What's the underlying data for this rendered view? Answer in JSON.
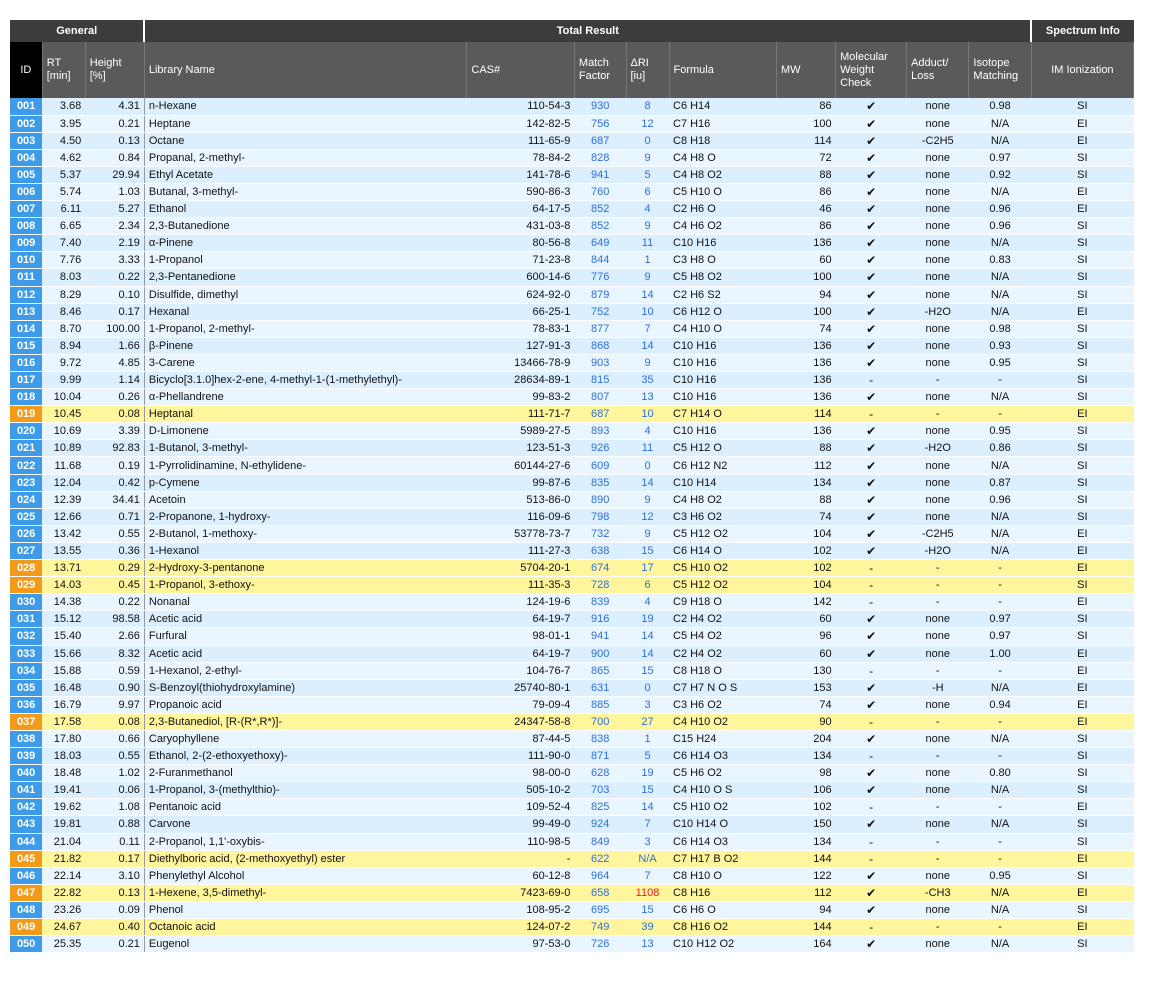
{
  "groups": {
    "general": "General",
    "total": "Total Result",
    "spectrum": "Spectrum Info"
  },
  "columns": {
    "id": "ID",
    "rt": "RT [min]",
    "height": "Height [%]",
    "library": "Library Name",
    "cas": "CAS#",
    "match": "Match Factor",
    "dri": "ΔRI [iu]",
    "formula": "Formula",
    "mw": "MW",
    "mwcheck": "Molecular Weight Check",
    "adduct": "Adduct/ Loss",
    "isotope": "Isotope Matching",
    "ion": "IM Ionization"
  },
  "colors": {
    "highlight": "#fff59d",
    "id_blue": "#3d9be8",
    "id_orange": "#f29a1a",
    "link_blue": "#2f6fd6",
    "alert_red": "#e02020"
  },
  "rows": [
    {
      "id": "001",
      "rt": "3.68",
      "height": "4.31",
      "name": "n-Hexane",
      "cas": "110-54-3",
      "match": "930",
      "dri": "8",
      "formula": "C6 H14",
      "mw": "86",
      "check": "✔",
      "adduct": "none",
      "isotope": "0.98",
      "ion": "SI",
      "hl": false
    },
    {
      "id": "002",
      "rt": "3.95",
      "height": "0.21",
      "name": "Heptane",
      "cas": "142-82-5",
      "match": "756",
      "dri": "12",
      "formula": "C7 H16",
      "mw": "100",
      "check": "✔",
      "adduct": "none",
      "isotope": "N/A",
      "ion": "EI",
      "hl": false
    },
    {
      "id": "003",
      "rt": "4.50",
      "height": "0.13",
      "name": "Octane",
      "cas": "111-65-9",
      "match": "687",
      "dri": "0",
      "formula": "C8 H18",
      "mw": "114",
      "check": "✔",
      "adduct": "-C2H5",
      "isotope": "N/A",
      "ion": "EI",
      "hl": false
    },
    {
      "id": "004",
      "rt": "4.62",
      "height": "0.84",
      "name": "Propanal, 2-methyl-",
      "cas": "78-84-2",
      "match": "828",
      "dri": "9",
      "formula": "C4 H8 O",
      "mw": "72",
      "check": "✔",
      "adduct": "none",
      "isotope": "0.97",
      "ion": "SI",
      "hl": false
    },
    {
      "id": "005",
      "rt": "5.37",
      "height": "29.94",
      "name": "Ethyl Acetate",
      "cas": "141-78-6",
      "match": "941",
      "dri": "5",
      "formula": "C4 H8 O2",
      "mw": "88",
      "check": "✔",
      "adduct": "none",
      "isotope": "0.92",
      "ion": "SI",
      "hl": false
    },
    {
      "id": "006",
      "rt": "5.74",
      "height": "1.03",
      "name": "Butanal, 3-methyl-",
      "cas": "590-86-3",
      "match": "760",
      "dri": "6",
      "formula": "C5 H10 O",
      "mw": "86",
      "check": "✔",
      "adduct": "none",
      "isotope": "N/A",
      "ion": "EI",
      "hl": false
    },
    {
      "id": "007",
      "rt": "6.11",
      "height": "5.27",
      "name": "Ethanol",
      "cas": "64-17-5",
      "match": "852",
      "dri": "4",
      "formula": "C2 H6 O",
      "mw": "46",
      "check": "✔",
      "adduct": "none",
      "isotope": "0.96",
      "ion": "EI",
      "hl": false
    },
    {
      "id": "008",
      "rt": "6.65",
      "height": "2.34",
      "name": "2,3-Butanedione",
      "cas": "431-03-8",
      "match": "852",
      "dri": "9",
      "formula": "C4 H6 O2",
      "mw": "86",
      "check": "✔",
      "adduct": "none",
      "isotope": "0.96",
      "ion": "SI",
      "hl": false
    },
    {
      "id": "009",
      "rt": "7.40",
      "height": "2.19",
      "name": "α-Pinene",
      "cas": "80-56-8",
      "match": "649",
      "dri": "11",
      "formula": "C10 H16",
      "mw": "136",
      "check": "✔",
      "adduct": "none",
      "isotope": "N/A",
      "ion": "SI",
      "hl": false
    },
    {
      "id": "010",
      "rt": "7.76",
      "height": "3.33",
      "name": "1-Propanol",
      "cas": "71-23-8",
      "match": "844",
      "dri": "1",
      "formula": "C3 H8 O",
      "mw": "60",
      "check": "✔",
      "adduct": "none",
      "isotope": "0.83",
      "ion": "SI",
      "hl": false
    },
    {
      "id": "011",
      "rt": "8.03",
      "height": "0.22",
      "name": "2,3-Pentanedione",
      "cas": "600-14-6",
      "match": "776",
      "dri": "9",
      "formula": "C5 H8 O2",
      "mw": "100",
      "check": "✔",
      "adduct": "none",
      "isotope": "N/A",
      "ion": "SI",
      "hl": false
    },
    {
      "id": "012",
      "rt": "8.29",
      "height": "0.10",
      "name": "Disulfide, dimethyl",
      "cas": "624-92-0",
      "match": "879",
      "dri": "14",
      "formula": "C2 H6 S2",
      "mw": "94",
      "check": "✔",
      "adduct": "none",
      "isotope": "N/A",
      "ion": "SI",
      "hl": false
    },
    {
      "id": "013",
      "rt": "8.46",
      "height": "0.17",
      "name": "Hexanal",
      "cas": "66-25-1",
      "match": "752",
      "dri": "10",
      "formula": "C6 H12 O",
      "mw": "100",
      "check": "✔",
      "adduct": "-H2O",
      "isotope": "N/A",
      "ion": "EI",
      "hl": false
    },
    {
      "id": "014",
      "rt": "8.70",
      "height": "100.00",
      "name": "1-Propanol, 2-methyl-",
      "cas": "78-83-1",
      "match": "877",
      "dri": "7",
      "formula": "C4 H10 O",
      "mw": "74",
      "check": "✔",
      "adduct": "none",
      "isotope": "0.98",
      "ion": "SI",
      "hl": false
    },
    {
      "id": "015",
      "rt": "8.94",
      "height": "1.66",
      "name": "β-Pinene",
      "cas": "127-91-3",
      "match": "868",
      "dri": "14",
      "formula": "C10 H16",
      "mw": "136",
      "check": "✔",
      "adduct": "none",
      "isotope": "0.93",
      "ion": "SI",
      "hl": false
    },
    {
      "id": "016",
      "rt": "9.72",
      "height": "4.85",
      "name": "3-Carene",
      "cas": "13466-78-9",
      "match": "903",
      "dri": "9",
      "formula": "C10 H16",
      "mw": "136",
      "check": "✔",
      "adduct": "none",
      "isotope": "0.95",
      "ion": "SI",
      "hl": false
    },
    {
      "id": "017",
      "rt": "9.99",
      "height": "1.14",
      "name": "Bicyclo[3.1.0]hex-2-ene, 4-methyl-1-(1-methylethyl)-",
      "cas": "28634-89-1",
      "match": "815",
      "dri": "35",
      "formula": "C10 H16",
      "mw": "136",
      "check": "-",
      "adduct": "-",
      "isotope": "-",
      "ion": "SI",
      "hl": false
    },
    {
      "id": "018",
      "rt": "10.04",
      "height": "0.26",
      "name": "α-Phellandrene",
      "cas": "99-83-2",
      "match": "807",
      "dri": "13",
      "formula": "C10 H16",
      "mw": "136",
      "check": "✔",
      "adduct": "none",
      "isotope": "N/A",
      "ion": "SI",
      "hl": false
    },
    {
      "id": "019",
      "rt": "10.45",
      "height": "0.08",
      "name": "Heptanal",
      "cas": "111-71-7",
      "match": "687",
      "dri": "10",
      "formula": "C7 H14 O",
      "mw": "114",
      "check": "-",
      "adduct": "-",
      "isotope": "-",
      "ion": "EI",
      "hl": true
    },
    {
      "id": "020",
      "rt": "10.69",
      "height": "3.39",
      "name": "D-Limonene",
      "cas": "5989-27-5",
      "match": "893",
      "dri": "4",
      "formula": "C10 H16",
      "mw": "136",
      "check": "✔",
      "adduct": "none",
      "isotope": "0.95",
      "ion": "SI",
      "hl": false
    },
    {
      "id": "021",
      "rt": "10.89",
      "height": "92.83",
      "name": "1-Butanol, 3-methyl-",
      "cas": "123-51-3",
      "match": "926",
      "dri": "11",
      "formula": "C5 H12 O",
      "mw": "88",
      "check": "✔",
      "adduct": "-H2O",
      "isotope": "0.86",
      "ion": "SI",
      "hl": false
    },
    {
      "id": "022",
      "rt": "11.68",
      "height": "0.19",
      "name": "1-Pyrrolidinamine, N-ethylidene-",
      "cas": "60144-27-6",
      "match": "609",
      "dri": "0",
      "formula": "C6 H12 N2",
      "mw": "112",
      "check": "✔",
      "adduct": "none",
      "isotope": "N/A",
      "ion": "SI",
      "hl": false
    },
    {
      "id": "023",
      "rt": "12.04",
      "height": "0.42",
      "name": "p-Cymene",
      "cas": "99-87-6",
      "match": "835",
      "dri": "14",
      "formula": "C10 H14",
      "mw": "134",
      "check": "✔",
      "adduct": "none",
      "isotope": "0.87",
      "ion": "SI",
      "hl": false
    },
    {
      "id": "024",
      "rt": "12.39",
      "height": "34.41",
      "name": "Acetoin",
      "cas": "513-86-0",
      "match": "890",
      "dri": "9",
      "formula": "C4 H8 O2",
      "mw": "88",
      "check": "✔",
      "adduct": "none",
      "isotope": "0.96",
      "ion": "SI",
      "hl": false
    },
    {
      "id": "025",
      "rt": "12.66",
      "height": "0.71",
      "name": "2-Propanone, 1-hydroxy-",
      "cas": "116-09-6",
      "match": "798",
      "dri": "12",
      "formula": "C3 H6 O2",
      "mw": "74",
      "check": "✔",
      "adduct": "none",
      "isotope": "N/A",
      "ion": "SI",
      "hl": false
    },
    {
      "id": "026",
      "rt": "13.42",
      "height": "0.55",
      "name": "2-Butanol, 1-methoxy-",
      "cas": "53778-73-7",
      "match": "732",
      "dri": "9",
      "formula": "C5 H12 O2",
      "mw": "104",
      "check": "✔",
      "adduct": "-C2H5",
      "isotope": "N/A",
      "ion": "EI",
      "hl": false
    },
    {
      "id": "027",
      "rt": "13.55",
      "height": "0.36",
      "name": "1-Hexanol",
      "cas": "111-27-3",
      "match": "638",
      "dri": "15",
      "formula": "C6 H14 O",
      "mw": "102",
      "check": "✔",
      "adduct": "-H2O",
      "isotope": "N/A",
      "ion": "EI",
      "hl": false
    },
    {
      "id": "028",
      "rt": "13.71",
      "height": "0.29",
      "name": "2-Hydroxy-3-pentanone",
      "cas": "5704-20-1",
      "match": "674",
      "dri": "17",
      "formula": "C5 H10 O2",
      "mw": "102",
      "check": "-",
      "adduct": "-",
      "isotope": "-",
      "ion": "EI",
      "hl": true
    },
    {
      "id": "029",
      "rt": "14.03",
      "height": "0.45",
      "name": "1-Propanol, 3-ethoxy-",
      "cas": "111-35-3",
      "match": "728",
      "dri": "6",
      "formula": "C5 H12 O2",
      "mw": "104",
      "check": "-",
      "adduct": "-",
      "isotope": "-",
      "ion": "SI",
      "hl": true
    },
    {
      "id": "030",
      "rt": "14.38",
      "height": "0.22",
      "name": "Nonanal",
      "cas": "124-19-6",
      "match": "839",
      "dri": "4",
      "formula": "C9 H18 O",
      "mw": "142",
      "check": "-",
      "adduct": "-",
      "isotope": "-",
      "ion": "EI",
      "hl": false
    },
    {
      "id": "031",
      "rt": "15.12",
      "height": "98.58",
      "name": "Acetic acid",
      "cas": "64-19-7",
      "match": "916",
      "dri": "19",
      "formula": "C2 H4 O2",
      "mw": "60",
      "check": "✔",
      "adduct": "none",
      "isotope": "0.97",
      "ion": "SI",
      "hl": false
    },
    {
      "id": "032",
      "rt": "15.40",
      "height": "2.66",
      "name": "Furfural",
      "cas": "98-01-1",
      "match": "941",
      "dri": "14",
      "formula": "C5 H4 O2",
      "mw": "96",
      "check": "✔",
      "adduct": "none",
      "isotope": "0.97",
      "ion": "SI",
      "hl": false
    },
    {
      "id": "033",
      "rt": "15.66",
      "height": "8.32",
      "name": "Acetic acid",
      "cas": "64-19-7",
      "match": "900",
      "dri": "14",
      "formula": "C2 H4 O2",
      "mw": "60",
      "check": "✔",
      "adduct": "none",
      "isotope": "1.00",
      "ion": "EI",
      "hl": false
    },
    {
      "id": "034",
      "rt": "15.88",
      "height": "0.59",
      "name": "1-Hexanol, 2-ethyl-",
      "cas": "104-76-7",
      "match": "865",
      "dri": "15",
      "formula": "C8 H18 O",
      "mw": "130",
      "check": "-",
      "adduct": "-",
      "isotope": "-",
      "ion": "EI",
      "hl": false
    },
    {
      "id": "035",
      "rt": "16.48",
      "height": "0.90",
      "name": "S-Benzoyl(thiohydroxylamine)",
      "cas": "25740-80-1",
      "match": "631",
      "dri": "0",
      "formula": "C7 H7 N O S",
      "mw": "153",
      "check": "✔",
      "adduct": "-H",
      "isotope": "N/A",
      "ion": "EI",
      "hl": false
    },
    {
      "id": "036",
      "rt": "16.79",
      "height": "9.97",
      "name": "Propanoic acid",
      "cas": "79-09-4",
      "match": "885",
      "dri": "3",
      "formula": "C3 H6 O2",
      "mw": "74",
      "check": "✔",
      "adduct": "none",
      "isotope": "0.94",
      "ion": "EI",
      "hl": false
    },
    {
      "id": "037",
      "rt": "17.58",
      "height": "0.08",
      "name": "2,3-Butanediol, [R-(R*,R*)]-",
      "cas": "24347-58-8",
      "match": "700",
      "dri": "27",
      "formula": "C4 H10 O2",
      "mw": "90",
      "check": "-",
      "adduct": "-",
      "isotope": "-",
      "ion": "EI",
      "hl": true
    },
    {
      "id": "038",
      "rt": "17.80",
      "height": "0.66",
      "name": "Caryophyllene",
      "cas": "87-44-5",
      "match": "838",
      "dri": "1",
      "formula": "C15 H24",
      "mw": "204",
      "check": "✔",
      "adduct": "none",
      "isotope": "N/A",
      "ion": "SI",
      "hl": false
    },
    {
      "id": "039",
      "rt": "18.03",
      "height": "0.55",
      "name": "Ethanol, 2-(2-ethoxyethoxy)-",
      "cas": "111-90-0",
      "match": "871",
      "dri": "5",
      "formula": "C6 H14 O3",
      "mw": "134",
      "check": "-",
      "adduct": "-",
      "isotope": "-",
      "ion": "SI",
      "hl": false
    },
    {
      "id": "040",
      "rt": "18.48",
      "height": "1.02",
      "name": "2-Furanmethanol",
      "cas": "98-00-0",
      "match": "628",
      "dri": "19",
      "formula": "C5 H6 O2",
      "mw": "98",
      "check": "✔",
      "adduct": "none",
      "isotope": "0.80",
      "ion": "SI",
      "hl": false
    },
    {
      "id": "041",
      "rt": "19.41",
      "height": "0.06",
      "name": "1-Propanol, 3-(methylthio)-",
      "cas": "505-10-2",
      "match": "703",
      "dri": "15",
      "formula": "C4 H10 O S",
      "mw": "106",
      "check": "✔",
      "adduct": "none",
      "isotope": "N/A",
      "ion": "SI",
      "hl": false
    },
    {
      "id": "042",
      "rt": "19.62",
      "height": "1.08",
      "name": "Pentanoic acid",
      "cas": "109-52-4",
      "match": "825",
      "dri": "14",
      "formula": "C5 H10 O2",
      "mw": "102",
      "check": "-",
      "adduct": "-",
      "isotope": "-",
      "ion": "EI",
      "hl": false
    },
    {
      "id": "043",
      "rt": "19.81",
      "height": "0.88",
      "name": "Carvone",
      "cas": "99-49-0",
      "match": "924",
      "dri": "7",
      "formula": "C10 H14 O",
      "mw": "150",
      "check": "✔",
      "adduct": "none",
      "isotope": "N/A",
      "ion": "SI",
      "hl": false
    },
    {
      "id": "044",
      "rt": "21.04",
      "height": "0.11",
      "name": "2-Propanol, 1,1'-oxybis-",
      "cas": "110-98-5",
      "match": "849",
      "dri": "3",
      "formula": "C6 H14 O3",
      "mw": "134",
      "check": "-",
      "adduct": "-",
      "isotope": "-",
      "ion": "SI",
      "hl": false
    },
    {
      "id": "045",
      "rt": "21.82",
      "height": "0.17",
      "name": "Diethylboric acid, (2-methoxyethyl) ester",
      "cas": "-",
      "match": "622",
      "dri": "N/A",
      "formula": "C7 H17 B O2",
      "mw": "144",
      "check": "-",
      "adduct": "-",
      "isotope": "-",
      "ion": "EI",
      "hl": true
    },
    {
      "id": "046",
      "rt": "22.14",
      "height": "3.10",
      "name": "Phenylethyl Alcohol",
      "cas": "60-12-8",
      "match": "964",
      "dri": "7",
      "formula": "C8 H10 O",
      "mw": "122",
      "check": "✔",
      "adduct": "none",
      "isotope": "0.95",
      "ion": "SI",
      "hl": false
    },
    {
      "id": "047",
      "rt": "22.82",
      "height": "0.13",
      "name": "1-Hexene, 3,5-dimethyl-",
      "cas": "7423-69-0",
      "match": "658",
      "dri": "1108",
      "formula": "C8 H16",
      "mw": "112",
      "check": "✔",
      "adduct": "-CH3",
      "isotope": "N/A",
      "ion": "EI",
      "hl": true,
      "dri_alert": true
    },
    {
      "id": "048",
      "rt": "23.26",
      "height": "0.09",
      "name": "Phenol",
      "cas": "108-95-2",
      "match": "695",
      "dri": "15",
      "formula": "C6 H6 O",
      "mw": "94",
      "check": "✔",
      "adduct": "none",
      "isotope": "N/A",
      "ion": "SI",
      "hl": false
    },
    {
      "id": "049",
      "rt": "24.67",
      "height": "0.40",
      "name": "Octanoic acid",
      "cas": "124-07-2",
      "match": "749",
      "dri": "39",
      "formula": "C8 H16 O2",
      "mw": "144",
      "check": "-",
      "adduct": "-",
      "isotope": "-",
      "ion": "EI",
      "hl": true
    },
    {
      "id": "050",
      "rt": "25.35",
      "height": "0.21",
      "name": "Eugenol",
      "cas": "97-53-0",
      "match": "726",
      "dri": "13",
      "formula": "C10 H12 O2",
      "mw": "164",
      "check": "✔",
      "adduct": "none",
      "isotope": "N/A",
      "ion": "SI",
      "hl": false
    }
  ]
}
